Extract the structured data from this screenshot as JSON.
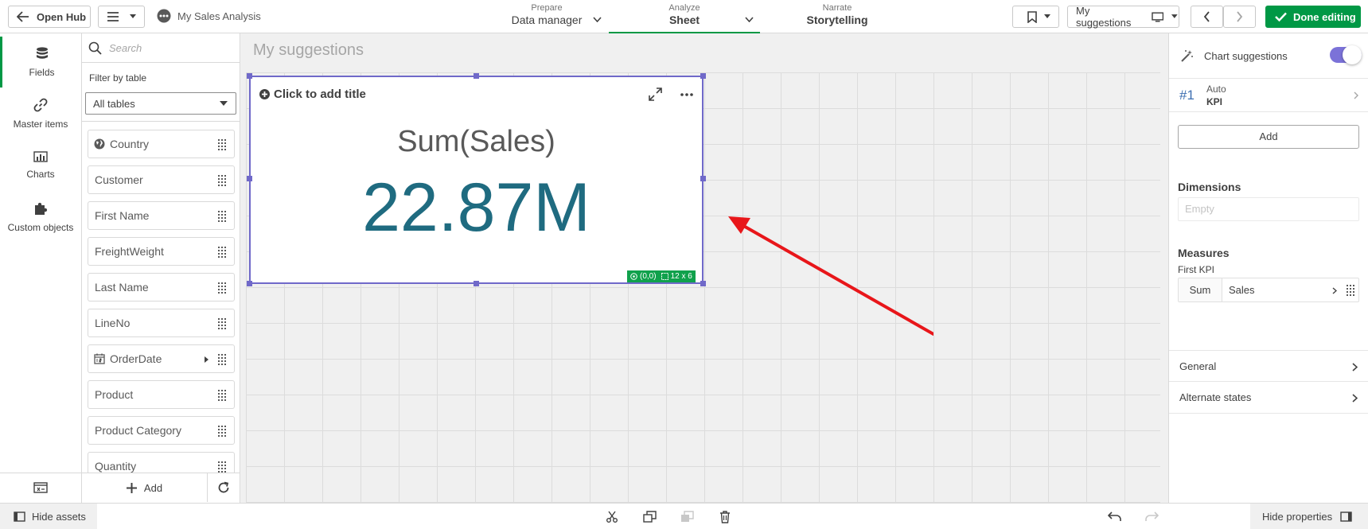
{
  "header": {
    "open_hub_label": "Open Hub",
    "app_name": "My Sales Analysis",
    "tabs": [
      {
        "caption": "Prepare",
        "label": "Data manager"
      },
      {
        "caption": "Analyze",
        "label": "Sheet"
      },
      {
        "caption": "Narrate",
        "label": "Storytelling"
      }
    ],
    "suggestions_label": "My suggestions",
    "done_label": "Done editing"
  },
  "left_rail": {
    "items": [
      {
        "label": "Fields",
        "icon": "database-icon"
      },
      {
        "label": "Master items",
        "icon": "link-icon"
      },
      {
        "label": "Charts",
        "icon": "bar-chart-icon"
      },
      {
        "label": "Custom objects",
        "icon": "puzzle-icon"
      }
    ]
  },
  "fields_panel": {
    "search_placeholder": "Search",
    "filter_label": "Filter by table",
    "filter_value": "All tables",
    "fields": [
      "Country",
      "Customer",
      "First Name",
      "FreightWeight",
      "Last Name",
      "LineNo",
      "OrderDate",
      "Product",
      "Product Category",
      "Quantity"
    ],
    "add_label": "Add"
  },
  "canvas": {
    "sheet_title": "My suggestions",
    "kpi": {
      "title_placeholder": "Click to add title",
      "measure_label": "Sum(Sales)",
      "value": "22.87M",
      "position_badge": "(0,0)",
      "size_badge": "12 x 6"
    }
  },
  "properties": {
    "chart_suggestions_label": "Chart suggestions",
    "chart_suggestions_on": true,
    "suggestion_rank": "#1",
    "suggestion_mode": "Auto",
    "suggestion_type": "KPI",
    "add_label": "Add",
    "dimensions_heading": "Dimensions",
    "dimensions_empty": "Empty",
    "measures_heading": "Measures",
    "measure_name": "First KPI",
    "measure_agg": "Sum",
    "measure_field": "Sales",
    "sections": [
      "General",
      "Alternate states"
    ]
  },
  "footer": {
    "hide_assets_label": "Hide assets",
    "hide_properties_label": "Hide properties"
  },
  "colors": {
    "brand_green": "#009845",
    "kpi_value": "#1f6b80",
    "selection_purple": "#7069c9",
    "annotation_red": "#e8161a",
    "toggle_purple": "#7b72d8"
  }
}
